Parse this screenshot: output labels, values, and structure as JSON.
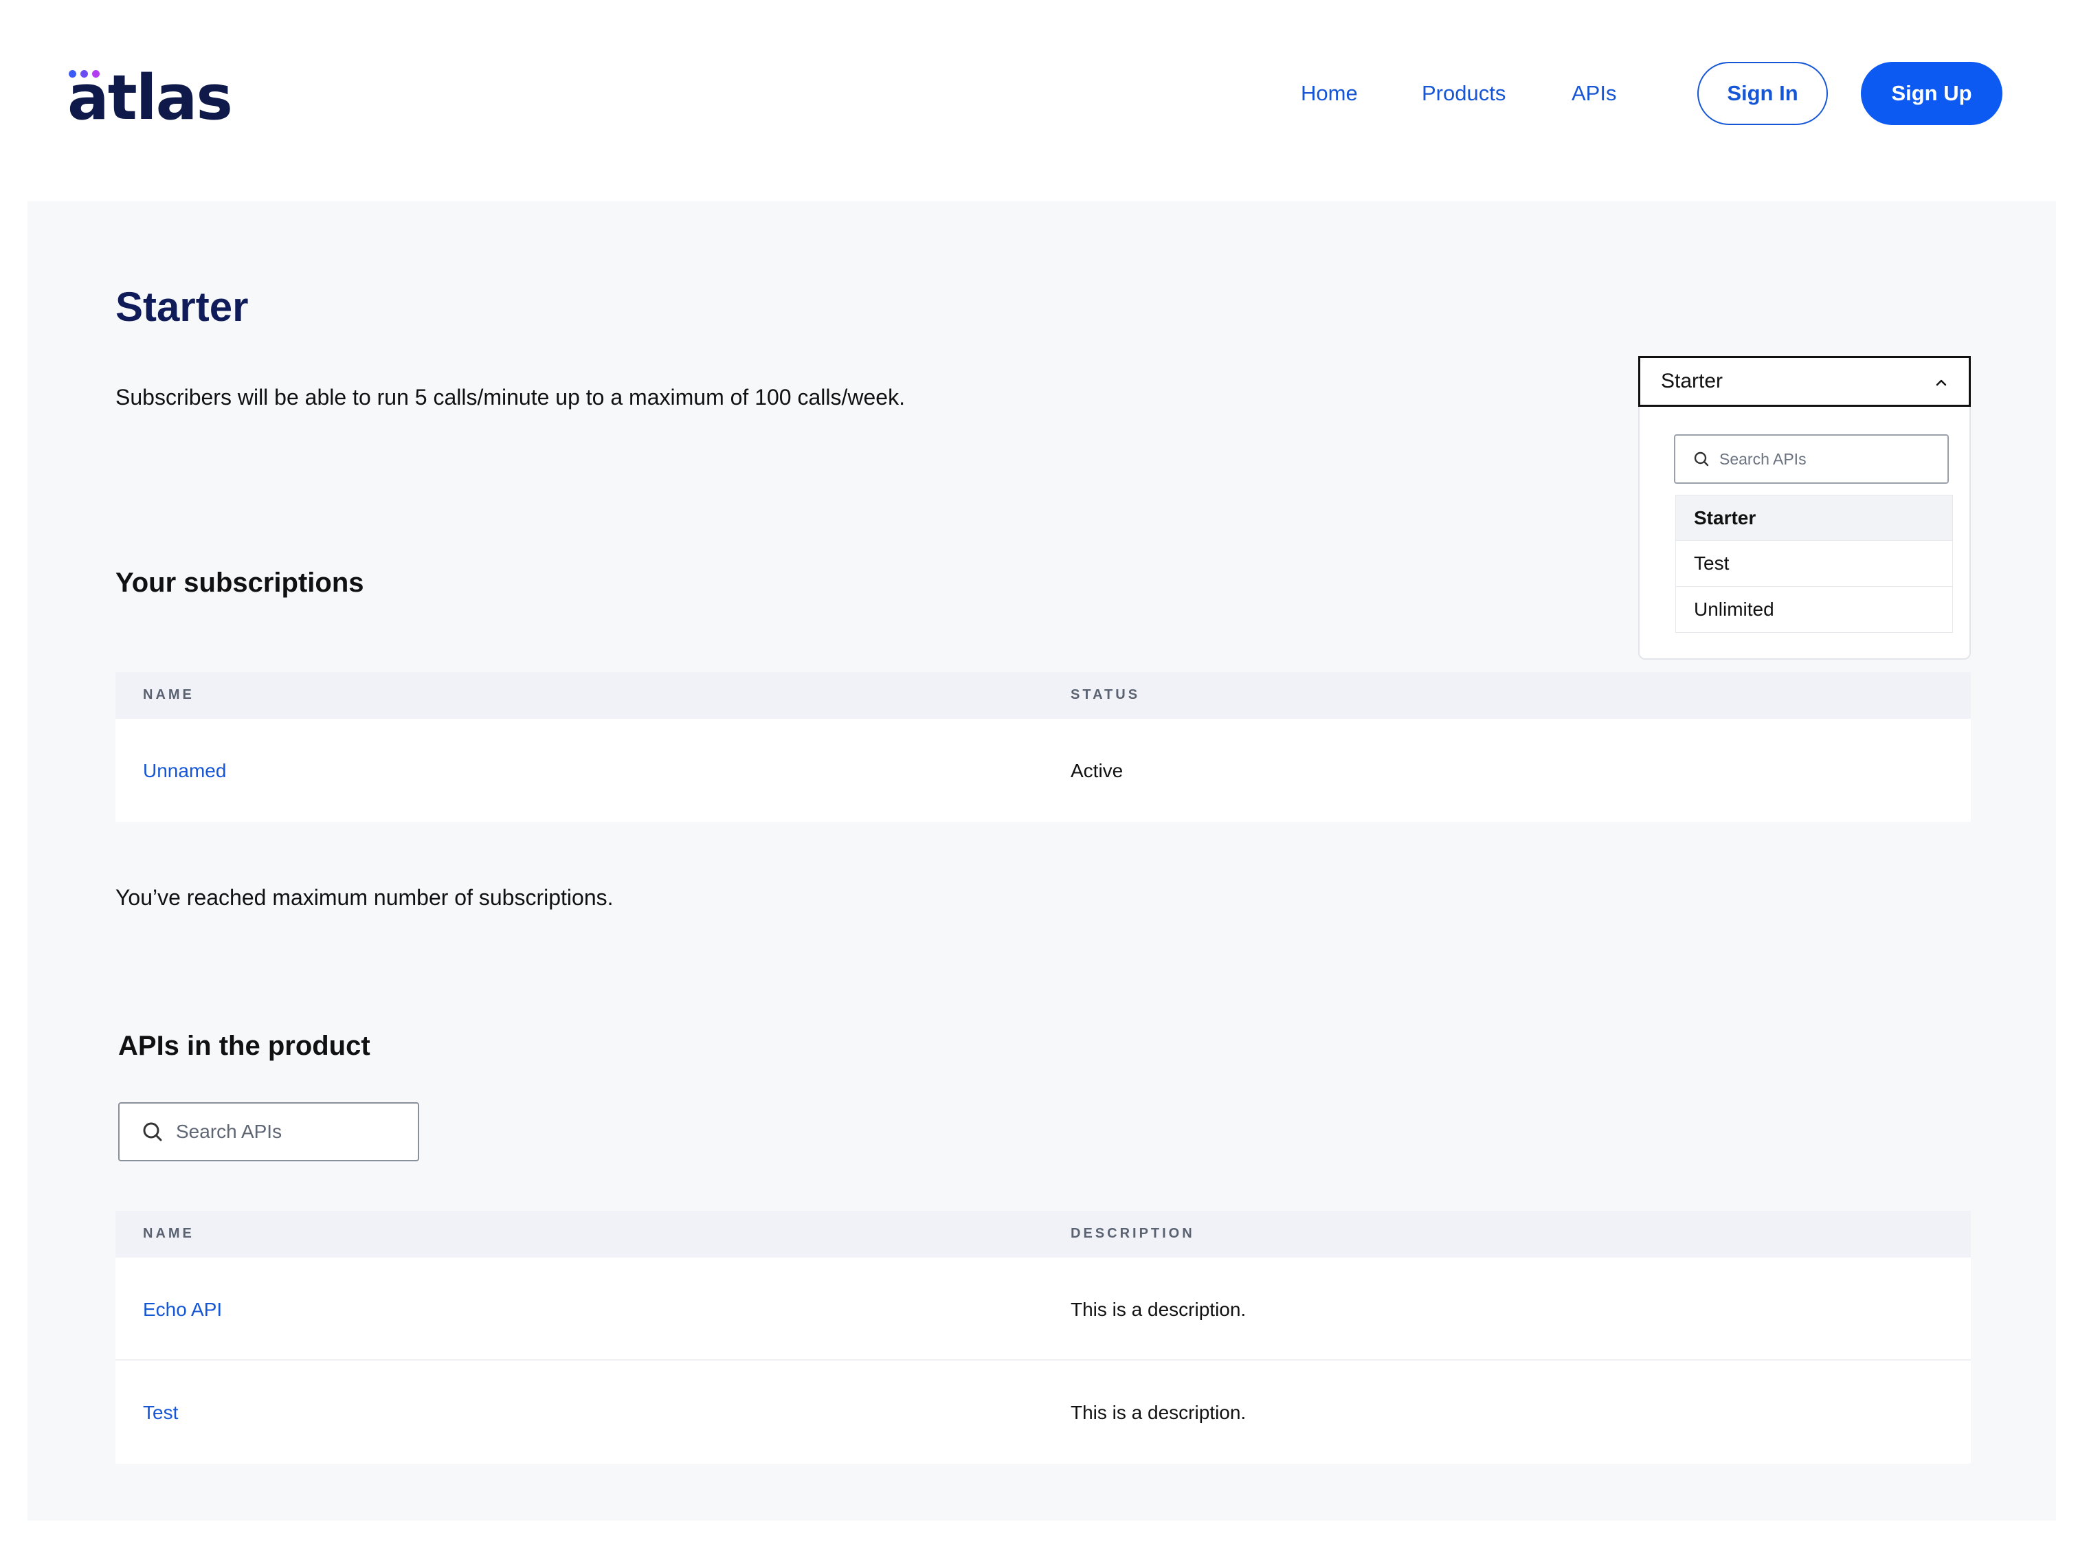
{
  "header": {
    "logo_text": "atlas",
    "nav": [
      {
        "label": "Home"
      },
      {
        "label": "Products"
      },
      {
        "label": "APIs"
      }
    ],
    "sign_in_label": "Sign In",
    "sign_up_label": "Sign Up"
  },
  "product": {
    "title": "Starter",
    "description": "Subscribers will be able to run 5 calls/minute up to a maximum of 100 calls/week."
  },
  "plan_dropdown": {
    "selected": "Starter",
    "expanded": true,
    "search_placeholder": "Search APIs",
    "options": [
      {
        "label": "Starter",
        "selected": true
      },
      {
        "label": "Test",
        "selected": false
      },
      {
        "label": "Unlimited",
        "selected": false
      }
    ]
  },
  "subscriptions": {
    "title": "Your subscriptions",
    "columns": [
      "NAME",
      "STATUS"
    ],
    "rows": [
      {
        "name": "Unnamed",
        "status": "Active"
      }
    ],
    "limit_note": "You’ve reached maximum number of subscriptions."
  },
  "apis": {
    "title": "APIs in the product",
    "search_placeholder": "Search APIs",
    "columns": [
      "NAME",
      "DESCRIPTION"
    ],
    "rows": [
      {
        "name": "Echo API",
        "description": "This is a description."
      },
      {
        "name": "Test",
        "description": "This is a description."
      }
    ]
  },
  "colors": {
    "brand": "#0c5af2",
    "link": "#1556d6",
    "title": "#101c5a",
    "panel_bg": "#f7f8fa"
  },
  "icons": {
    "search": "search-icon",
    "chevron": "chevron-up-icon"
  }
}
